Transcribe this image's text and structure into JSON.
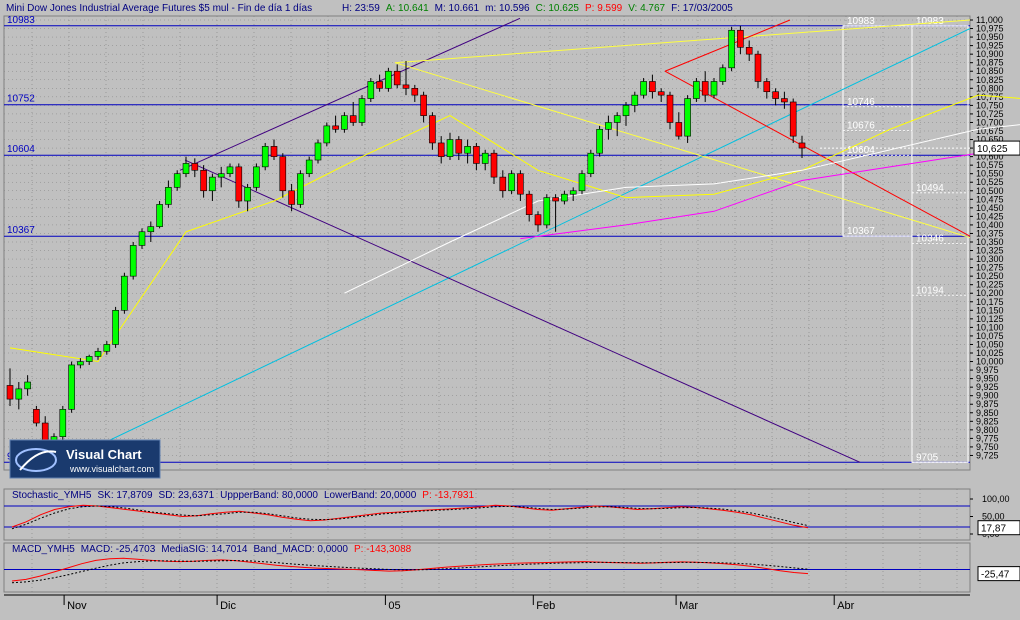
{
  "header": {
    "symbol": "Mini Dow Jones Industrial Average Futures $5 mul",
    "period": "Fin de día 1 días",
    "date": "17/03/2005",
    "fields": [
      {
        "label": "H:",
        "value": "23:59",
        "color": "#000080"
      },
      {
        "label": "A:",
        "value": "10.641",
        "color": "#008000"
      },
      {
        "label": "M:",
        "value": "10.661",
        "color": "#000080"
      },
      {
        "label": "m:",
        "value": "10.596",
        "color": "#000080"
      },
      {
        "label": "C:",
        "value": "10.625",
        "color": "#008000"
      },
      {
        "label": "P:",
        "value": "9.599",
        "color": "#ff0000"
      },
      {
        "label": "V:",
        "value": "4.767",
        "color": "#008000"
      },
      {
        "label": "F:",
        "value": "17/03/2005",
        "color": "#000080"
      }
    ]
  },
  "logo": {
    "brand": "Visual Chart",
    "url": "www.visualchart.com"
  },
  "colors": {
    "panel_bg": "#c0c0c0",
    "grid": "#808080",
    "up_candle": "#00ff00",
    "down_candle": "#ff0000",
    "level_line": "#0000c0",
    "ma_yellow": "#ffff00",
    "ma_white": "#ffffff",
    "ma_magenta": "#ff00ff",
    "trend_cyan": "#00c0e0",
    "trend_purple": "#400080",
    "fan_red": "#ff0000",
    "fan_yellow": "#ffff40"
  },
  "chart_data": [
    {
      "type": "candlestick",
      "title": "",
      "ylim": [
        9700,
        11000
      ],
      "y_ticks": [
        "11,000",
        "10,975",
        "10,950",
        "10,925",
        "10,900",
        "10,875",
        "10,850",
        "10,825",
        "10,800",
        "10,775",
        "10,750",
        "10,725",
        "10,700",
        "10,675",
        "10,650",
        "10,625",
        "10,600",
        "10,575",
        "10,550",
        "10,525",
        "10,500",
        "10,475",
        "10,450",
        "10,425",
        "10,400",
        "10,375",
        "10,350",
        "10,325",
        "10,300",
        "10,275",
        "10,250",
        "10,225",
        "10,200",
        "10,175",
        "10,150",
        "10,125",
        "10,100",
        "10,075",
        "10,050",
        "10,025",
        "10,000",
        "9,975",
        "9,950",
        "9,925",
        "9,900",
        "9,875",
        "9,850",
        "9,825",
        "9,800",
        "9,775",
        "9,750",
        "9,725"
      ],
      "x_labels": [
        {
          "label": "Nov",
          "date": "2004-11-01"
        },
        {
          "label": "Dic",
          "date": "2004-12-01"
        },
        {
          "label": "05",
          "date": "2005-01-03"
        },
        {
          "label": "Feb",
          "date": "2005-02-01"
        },
        {
          "label": "Mar",
          "date": "2005-03-01"
        },
        {
          "label": "Abr",
          "date": "2005-04-01"
        }
      ],
      "last_price_label": "10,625",
      "last_price": 10625,
      "levels": [
        {
          "label": "10983",
          "value": 10983
        },
        {
          "label": "10752",
          "value": 10752
        },
        {
          "label": "10604",
          "value": 10604
        },
        {
          "label": "10367",
          "value": 10367
        },
        {
          "label": "9705",
          "value": 9705
        }
      ],
      "retracement_box_1": [
        {
          "label": "10983",
          "value": 10983
        },
        {
          "label": "10746",
          "value": 10746
        },
        {
          "label": "10676",
          "value": 10676
        },
        {
          "label": "10604",
          "value": 10604
        },
        {
          "label": "10367",
          "value": 10367
        }
      ],
      "retracement_box_2": [
        {
          "label": "10983",
          "value": 10983
        },
        {
          "label": "10494",
          "value": 10494
        },
        {
          "label": "10346",
          "value": 10346
        },
        {
          "label": "10194",
          "value": 10194
        },
        {
          "label": "9705",
          "value": 9705
        }
      ],
      "candles": [
        [
          9930,
          9980,
          9870,
          9890
        ],
        [
          9890,
          9940,
          9860,
          9920
        ],
        [
          9920,
          9960,
          9900,
          9940
        ],
        [
          9860,
          9870,
          9810,
          9820
        ],
        [
          9820,
          9840,
          9730,
          9740
        ],
        [
          9740,
          9790,
          9730,
          9780
        ],
        [
          9780,
          9870,
          9770,
          9860
        ],
        [
          9860,
          10000,
          9850,
          9990
        ],
        [
          9990,
          10010,
          9980,
          10000
        ],
        [
          10000,
          10020,
          9990,
          10015
        ],
        [
          10015,
          10040,
          10005,
          10030
        ],
        [
          10030,
          10060,
          10020,
          10050
        ],
        [
          10050,
          10160,
          10040,
          10150
        ],
        [
          10150,
          10260,
          10140,
          10250
        ],
        [
          10250,
          10350,
          10240,
          10340
        ],
        [
          10340,
          10390,
          10330,
          10380
        ],
        [
          10380,
          10410,
          10350,
          10395
        ],
        [
          10395,
          10470,
          10390,
          10460
        ],
        [
          10460,
          10530,
          10450,
          10510
        ],
        [
          10510,
          10560,
          10500,
          10550
        ],
        [
          10550,
          10600,
          10540,
          10580
        ],
        [
          10580,
          10595,
          10540,
          10560
        ],
        [
          10560,
          10575,
          10480,
          10500
        ],
        [
          10500,
          10550,
          10470,
          10540
        ],
        [
          10540,
          10570,
          10510,
          10550
        ],
        [
          10550,
          10580,
          10540,
          10570
        ],
        [
          10570,
          10580,
          10450,
          10470
        ],
        [
          10470,
          10520,
          10440,
          10510
        ],
        [
          10510,
          10580,
          10500,
          10570
        ],
        [
          10570,
          10640,
          10560,
          10630
        ],
        [
          10630,
          10650,
          10590,
          10600
        ],
        [
          10600,
          10610,
          10480,
          10500
        ],
        [
          10500,
          10520,
          10440,
          10460
        ],
        [
          10460,
          10560,
          10450,
          10550
        ],
        [
          10550,
          10600,
          10540,
          10590
        ],
        [
          10590,
          10650,
          10580,
          10640
        ],
        [
          10640,
          10700,
          10630,
          10690
        ],
        [
          10690,
          10720,
          10670,
          10680
        ],
        [
          10680,
          10730,
          10670,
          10720
        ],
        [
          10720,
          10760,
          10690,
          10700
        ],
        [
          10700,
          10780,
          10690,
          10770
        ],
        [
          10770,
          10830,
          10760,
          10820
        ],
        [
          10820,
          10840,
          10790,
          10800
        ],
        [
          10800,
          10860,
          10790,
          10850
        ],
        [
          10850,
          10870,
          10800,
          10810
        ],
        [
          10810,
          10880,
          10780,
          10800
        ],
        [
          10800,
          10810,
          10760,
          10780
        ],
        [
          10780,
          10790,
          10700,
          10720
        ],
        [
          10720,
          10730,
          10620,
          10640
        ],
        [
          10640,
          10660,
          10580,
          10600
        ],
        [
          10600,
          10670,
          10590,
          10650
        ],
        [
          10650,
          10660,
          10590,
          10610
        ],
        [
          10610,
          10650,
          10580,
          10630
        ],
        [
          10630,
          10640,
          10560,
          10580
        ],
        [
          10580,
          10620,
          10560,
          10610
        ],
        [
          10610,
          10620,
          10520,
          10540
        ],
        [
          10540,
          10560,
          10480,
          10500
        ],
        [
          10500,
          10560,
          10490,
          10550
        ],
        [
          10550,
          10560,
          10470,
          10490
        ],
        [
          10490,
          10500,
          10410,
          10430
        ],
        [
          10430,
          10440,
          10380,
          10400
        ],
        [
          10400,
          10490,
          10390,
          10480
        ],
        [
          10480,
          10490,
          10380,
          10470
        ],
        [
          10470,
          10500,
          10460,
          10490
        ],
        [
          10490,
          10510,
          10470,
          10500
        ],
        [
          10500,
          10560,
          10490,
          10550
        ],
        [
          10550,
          10620,
          10540,
          10610
        ],
        [
          10610,
          10690,
          10600,
          10680
        ],
        [
          10680,
          10720,
          10650,
          10700
        ],
        [
          10700,
          10730,
          10660,
          10720
        ],
        [
          10720,
          10760,
          10690,
          10750
        ],
        [
          10750,
          10790,
          10730,
          10780
        ],
        [
          10780,
          10830,
          10770,
          10820
        ],
        [
          10820,
          10840,
          10770,
          10790
        ],
        [
          10790,
          10800,
          10760,
          10780
        ],
        [
          10780,
          10790,
          10680,
          10700
        ],
        [
          10700,
          10730,
          10650,
          10660
        ],
        [
          10660,
          10780,
          10640,
          10770
        ],
        [
          10770,
          10830,
          10760,
          10820
        ],
        [
          10820,
          10850,
          10760,
          10780
        ],
        [
          10780,
          10830,
          10770,
          10820
        ],
        [
          10820,
          10870,
          10810,
          10860
        ],
        [
          10860,
          10980,
          10850,
          10970
        ],
        [
          10970,
          10983,
          10900,
          10920
        ],
        [
          10920,
          10940,
          10880,
          10900
        ],
        [
          10900,
          10910,
          10800,
          10820
        ],
        [
          10820,
          10830,
          10770,
          10790
        ],
        [
          10790,
          10800,
          10750,
          10770
        ],
        [
          10770,
          10790,
          10740,
          10760
        ],
        [
          10760,
          10770,
          10640,
          10660
        ],
        [
          10640,
          10661,
          10596,
          10625
        ]
      ],
      "ma_yellow": [
        [
          0,
          10040
        ],
        [
          10,
          10000
        ],
        [
          20,
          10380
        ],
        [
          30,
          10470
        ],
        [
          40,
          10600
        ],
        [
          50,
          10720
        ],
        [
          60,
          10560
        ],
        [
          70,
          10480
        ],
        [
          80,
          10490
        ],
        [
          90,
          10560
        ],
        [
          100,
          10680
        ],
        [
          110,
          10780
        ],
        [
          120,
          10760
        ]
      ],
      "ma_white": [
        [
          38,
          10200
        ],
        [
          50,
          10350
        ],
        [
          60,
          10470
        ],
        [
          70,
          10510
        ],
        [
          80,
          10520
        ],
        [
          90,
          10560
        ],
        [
          100,
          10620
        ],
        [
          110,
          10680
        ],
        [
          117,
          10700
        ]
      ],
      "ma_magenta": [
        [
          58,
          10360
        ],
        [
          70,
          10400
        ],
        [
          80,
          10440
        ],
        [
          90,
          10530
        ],
        [
          100,
          10570
        ],
        [
          110,
          10610
        ],
        [
          120,
          10620
        ]
      ]
    },
    {
      "type": "line",
      "title": "Stochastic_YMH5",
      "label_fields": [
        {
          "label": "SK:",
          "value": "17,8709"
        },
        {
          "label": "SD:",
          "value": "23,6371"
        },
        {
          "label": "UppperBand:",
          "value": "80,0000"
        },
        {
          "label": "LowerBand:",
          "value": "20,0000"
        },
        {
          "label": "P:",
          "value": "-13,7931"
        }
      ],
      "ylim": [
        0,
        100
      ],
      "y_ticks": [
        "100,00",
        "50,00",
        "0,00"
      ],
      "last_value_label": "17,87",
      "bands": [
        80,
        20
      ],
      "series": [
        {
          "name": "SK",
          "values": [
            20,
            35,
            55,
            70,
            78,
            82,
            80,
            75,
            70,
            65,
            60,
            55,
            50,
            52,
            58,
            62,
            65,
            60,
            55,
            48,
            42,
            38,
            40,
            45,
            50,
            55,
            60,
            62,
            65,
            68,
            70,
            72,
            75,
            78,
            82,
            80,
            75,
            70,
            68,
            72,
            76,
            80,
            78,
            74,
            70,
            72,
            75,
            78,
            76,
            72,
            68,
            62,
            55,
            45,
            35,
            25,
            18
          ]
        },
        {
          "name": "SD",
          "values": [
            15,
            28,
            45,
            60,
            72,
            78,
            80,
            78,
            74,
            68,
            62,
            58,
            54,
            52,
            55,
            58,
            62,
            62,
            58,
            52,
            46,
            42,
            41,
            43,
            47,
            52,
            57,
            60,
            63,
            66,
            68,
            70,
            72,
            75,
            78,
            79,
            77,
            73,
            70,
            71,
            74,
            77,
            78,
            76,
            73,
            72,
            73,
            75,
            76,
            74,
            71,
            66,
            60,
            52,
            43,
            33,
            24
          ]
        }
      ]
    },
    {
      "type": "line",
      "title": "MACD_YMH5",
      "label_fields": [
        {
          "label": "MACD:",
          "value": "-25,4703"
        },
        {
          "label": "MediaSIG:",
          "value": "14,7014"
        },
        {
          "label": "Band_MACD:",
          "value": "0,0000"
        },
        {
          "label": "P:",
          "value": "-143,3088"
        }
      ],
      "ylim": [
        -100,
        100
      ],
      "y_ticks": [],
      "last_value_label": "-25,47",
      "series": [
        {
          "name": "MACD",
          "values": [
            -70,
            -60,
            -40,
            -15,
            10,
            35,
            55,
            65,
            68,
            62,
            55,
            50,
            48,
            50,
            55,
            58,
            54,
            45,
            35,
            25,
            18,
            12,
            8,
            4,
            2,
            -2,
            -6,
            -10,
            -8,
            -2,
            6,
            14,
            20,
            25,
            30,
            34,
            38,
            40,
            42,
            44,
            46,
            48,
            45,
            42,
            40,
            38,
            40,
            44,
            46,
            44,
            40,
            35,
            28,
            18,
            6,
            -8,
            -18,
            -25
          ]
        },
        {
          "name": "MediaSIG",
          "values": [
            -80,
            -75,
            -65,
            -50,
            -32,
            -12,
            8,
            26,
            40,
            48,
            52,
            52,
            51,
            50,
            51,
            53,
            54,
            52,
            47,
            41,
            34,
            28,
            22,
            17,
            12,
            8,
            4,
            0,
            -2,
            -2,
            0,
            4,
            9,
            14,
            19,
            24,
            28,
            32,
            35,
            38,
            40,
            42,
            43,
            43,
            42,
            41,
            41,
            42,
            43,
            43,
            42,
            40,
            37,
            32,
            26,
            18,
            10,
            2
          ]
        }
      ]
    }
  ]
}
